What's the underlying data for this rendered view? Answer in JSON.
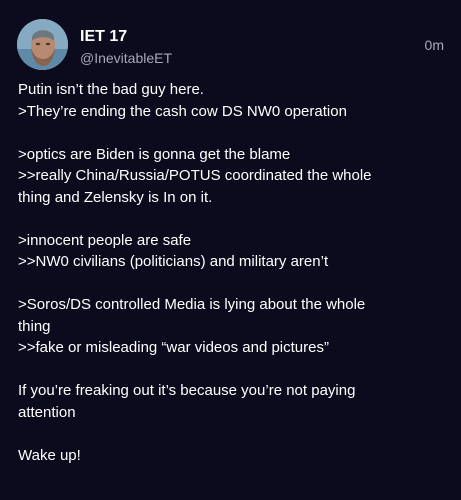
{
  "author": {
    "display_name": "IET 17",
    "handle": "@InevitableET",
    "avatar_icon": "user-avatar-photo"
  },
  "timestamp": "0m",
  "post": {
    "lines": [
      "Putin isn’t the bad guy here.",
      ">They’re ending the cash cow DS NW0 operation",
      "",
      ">optics are Biden is gonna get the blame",
      ">>really China/Russia/POTUS coordinated the whole",
      "thing and Zelensky is In on it.",
      "",
      ">innocent people are safe",
      ">>NW0 civilians (politicians) and military aren’t",
      "",
      ">Soros/DS controlled Media is lying about the whole",
      "thing",
      ">>fake or misleading “war videos and pictures”",
      "",
      "If you’re freaking out it’s because you’re not paying",
      "attention",
      "",
      "Wake up!"
    ]
  },
  "colors": {
    "background": "#0b0b1d",
    "text": "#ffffff",
    "muted": "#a7a7b6"
  }
}
